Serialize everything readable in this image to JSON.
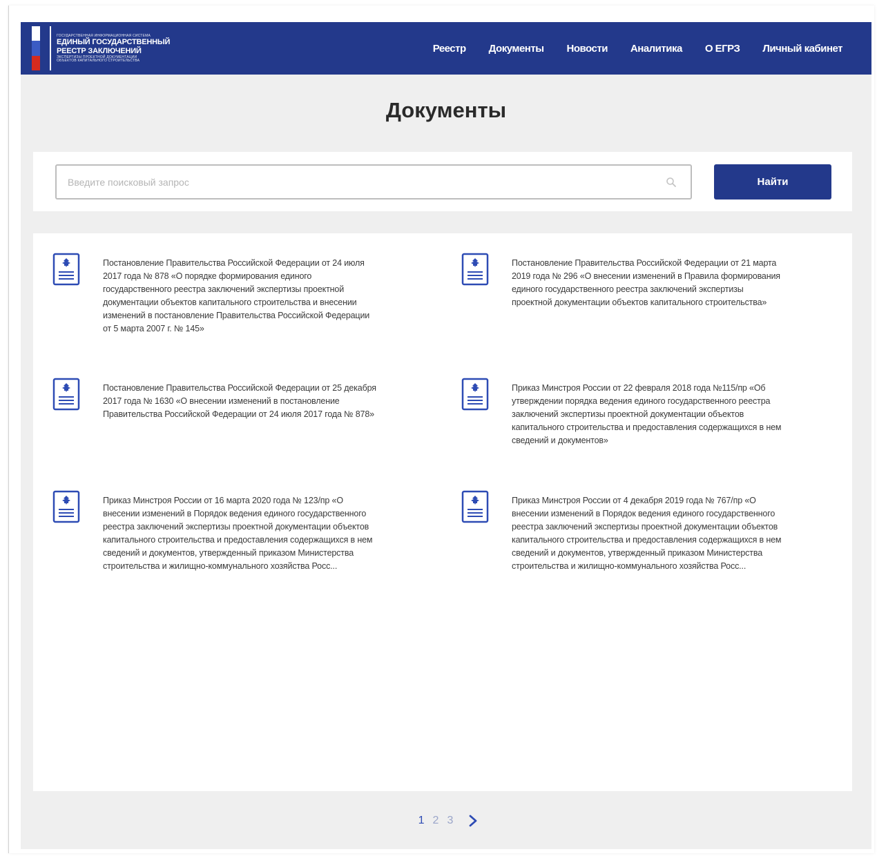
{
  "header": {
    "logo": {
      "line1": "ГОСУДАРСТВЕННАЯ ИНФОРМАЦИОННАЯ СИСТЕМА",
      "line2": "ЕДИНЫЙ ГОСУДАРСТВЕННЫЙ",
      "line3": "РЕЕСТР ЗАКЛЮЧЕНИЙ",
      "line4": "ЭКСПЕРТИЗЫ ПРОЕКТНОЙ ДОКУМЕНТАЦИИ",
      "line5": "ОБЪЕКТОВ КАПИТАЛЬНОГО СТРОИТЕЛЬСТВА"
    },
    "nav": [
      "Реестр",
      "Документы",
      "Новости",
      "Аналитика",
      "О ЕГРЗ",
      "Личный кабинет"
    ]
  },
  "page_title": "Документы",
  "search": {
    "placeholder": "Введите поисковый запрос",
    "value": "",
    "button_label": "Найти"
  },
  "documents": [
    {
      "text": "Постановление Правительства Российской Федерации от 24 июля 2017 года № 878 «О порядке формирования единого государственного реестра заключений экспертизы проектной документации объектов капитального строительства и внесении изменений в постановление Правительства Российской Федерации от 5 марта 2007 г. № 145»"
    },
    {
      "text": "Постановление Правительства Российской Федерации от 21 марта 2019 года № 296 «О внесении изменений в Правила формирования единого государственного реестра заключений экспертизы проектной документации объектов капитального строительства»"
    },
    {
      "text": "Постановление Правительства Российской Федерации от 25 декабря 2017 года № 1630 «О внесении изменений в постановление Правительства Российской Федерации от 24 июля 2017 года № 878»"
    },
    {
      "text": "Приказ Минстроя России от 22 февраля 2018 года №115/пр «Об утверждении порядка ведения единого государственного реестра заключений экспертизы проектной документации объектов капитального строительства и предоставления содержащихся в нем сведений и документов»"
    },
    {
      "text": "Приказ Минстроя России от 16 марта 2020 года № 123/пр «О внесении изменений в Порядок ведения единого государственного реестра заключений экспертизы проектной документации объектов капитального строительства и предоставления содержащихся в нем сведений и документов, утвержденный приказом Министерства строительства и жилищно-коммунального хозяйства Росс..."
    },
    {
      "text": "Приказ Минстроя России от 4 декабря 2019 года № 767/пр «О внесении изменений в Порядок ведения единого государственного реестра заключений экспертизы проектной документации объектов капитального строительства и предоставления содержащихся в нем сведений и документов, утвержденный приказом Министерства строительства и жилищно-коммунального хозяйства Росс..."
    }
  ],
  "pagination": {
    "pages": [
      "1",
      "2",
      "3"
    ],
    "current": "1"
  },
  "colors": {
    "header_bg": "#23398b",
    "button_bg": "#23398b",
    "icon_blue": "#2d4bb4",
    "page_bg": "#efefef"
  },
  "icons": {
    "document": "document-emblem-icon",
    "search": "search-icon",
    "next": "chevron-right-icon"
  }
}
